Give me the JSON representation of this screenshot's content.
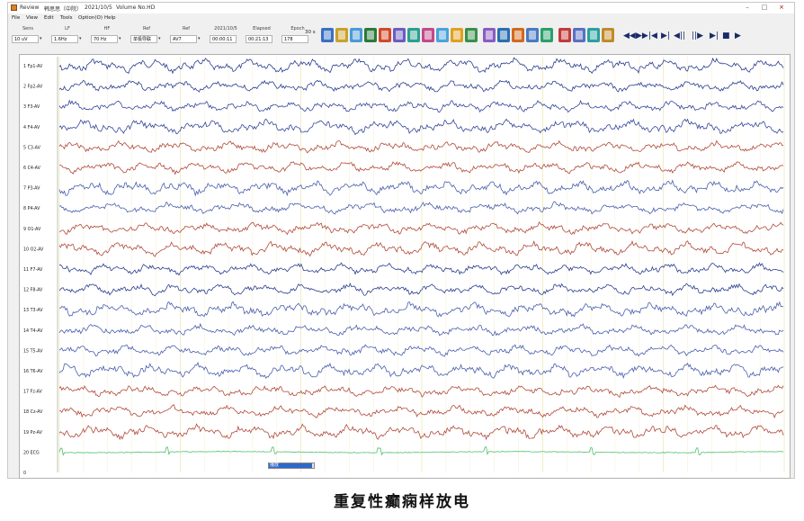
{
  "window": {
    "app_name": "Review",
    "patient": "韩思思（中院）",
    "date": "2021/10/5",
    "volume": "Volume No.HD",
    "min_icon": "minimize-icon",
    "max_icon": "maximize-icon",
    "close_icon": "close-icon"
  },
  "menu": [
    "File",
    "View",
    "Edit",
    "Tools",
    "Option(O)",
    "Help"
  ],
  "params": [
    {
      "label": "Sens",
      "value": "10 uV"
    },
    {
      "label": "LF",
      "value": "1.6Hz"
    },
    {
      "label": "HF",
      "value": "70 Hz"
    },
    {
      "label": "Ref",
      "value": "单极导联"
    },
    {
      "label": "Ref",
      "value": "AV7"
    },
    {
      "label": "2021/10/5",
      "value": "00:00:11"
    },
    {
      "label": "Elapsed",
      "value": "00:21:13"
    },
    {
      "label": "Epoch",
      "value": "178"
    }
  ],
  "toolbar": {
    "speed": "30 s",
    "buttons": [
      "new-record",
      "open",
      "annotate",
      "split",
      "print",
      "export",
      "import",
      "montage",
      "filter",
      "spike",
      "zoom",
      "compare",
      "bookmark",
      "report",
      "calendar",
      "chart",
      "video",
      "settings",
      "color",
      "help"
    ],
    "nav": [
      "◀◀",
      "▶▶",
      "|◀",
      "▶|",
      "◀||",
      "||▶",
      "▶|",
      "■",
      "▶"
    ]
  },
  "channels": [
    {
      "label": "1 Fp1-AV",
      "color": "#2a3d8f"
    },
    {
      "label": "2 Fp2-AV",
      "color": "#2a3d8f"
    },
    {
      "label": "3 F3-AV",
      "color": "#35479a"
    },
    {
      "label": "4 F4-AV",
      "color": "#35479a"
    },
    {
      "label": "5 C3-AV",
      "color": "#b04a3a"
    },
    {
      "label": "6 C4-AV",
      "color": "#b04a3a"
    },
    {
      "label": "7 P3-AV",
      "color": "#4a5fae"
    },
    {
      "label": "8 P4-AV",
      "color": "#4a5fae"
    },
    {
      "label": "9 O1-AV",
      "color": "#b04a3a"
    },
    {
      "label": "10 O2-AV",
      "color": "#b04a3a"
    },
    {
      "label": "11 F7-AV",
      "color": "#2a3d8f"
    },
    {
      "label": "12 F8-AV",
      "color": "#2a3d8f"
    },
    {
      "label": "13 T3-AV",
      "color": "#4a5fae"
    },
    {
      "label": "14 T4-AV",
      "color": "#4a5fae"
    },
    {
      "label": "15 T5-AV",
      "color": "#4a5fae"
    },
    {
      "label": "16 T6-AV",
      "color": "#4a5fae"
    },
    {
      "label": "17 Fz-AV",
      "color": "#b04a3a"
    },
    {
      "label": "18 Cz-AV",
      "color": "#b04a3a"
    },
    {
      "label": "19 Pz-AV",
      "color": "#b04a3a"
    },
    {
      "label": "20 ECG",
      "color": "#4fbf6a"
    },
    {
      "label": "0",
      "color": "#333333"
    }
  ],
  "status": {
    "progress_label": "播放",
    "progress": 0.95
  },
  "caption": "重复性癫痫样放电"
}
